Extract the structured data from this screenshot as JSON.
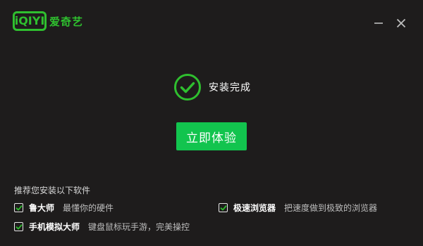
{
  "app": {
    "logo_mark": "iQIYI",
    "logo_text": "爱奇艺"
  },
  "window_controls": {
    "minimize_icon": "minimize-icon",
    "close_icon": "close-icon"
  },
  "status": {
    "icon": "check-circle-icon",
    "text": "安装完成"
  },
  "primary_action": {
    "label": "立即体验"
  },
  "recommendations": {
    "title": "推荐您安装以下软件",
    "items": [
      {
        "name": "鲁大师",
        "description": "最懂你的硬件",
        "checked": true
      },
      {
        "name": "极速浏览器",
        "description": "把速度做到极致的浏览器",
        "checked": true
      },
      {
        "name": "手机模拟大师",
        "description": "键盘鼠标玩手游，完美操控",
        "checked": true
      }
    ]
  },
  "colors": {
    "background": "#1e1c1c",
    "brand_green": "#2fbf2f",
    "button_green": "#12c44e",
    "text_primary": "#ffffff",
    "text_secondary": "#bdbdbd"
  }
}
